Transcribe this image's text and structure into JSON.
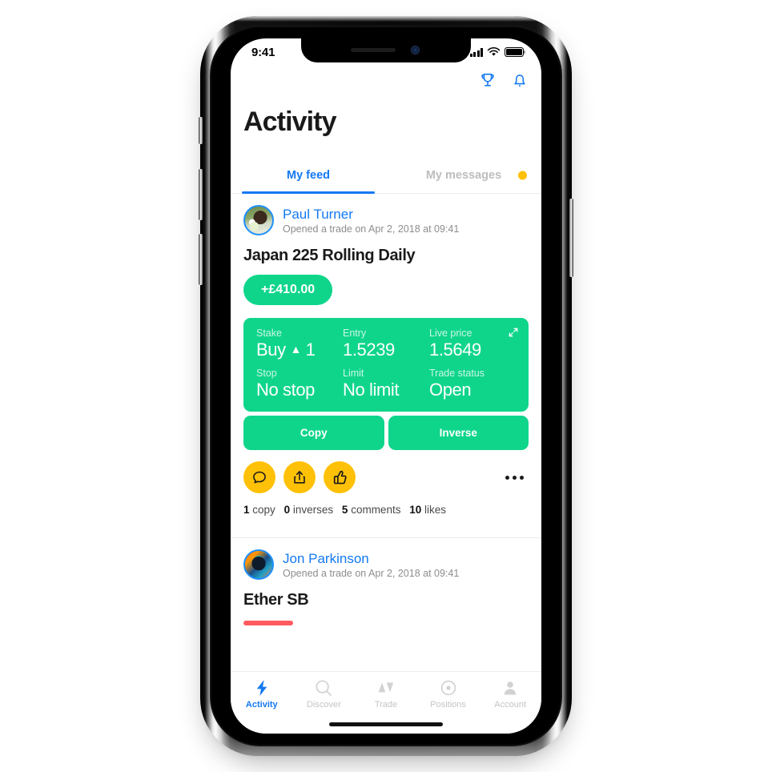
{
  "status_bar": {
    "time": "9:41",
    "signal_icon": "cellular-signal-icon",
    "wifi_icon": "wifi-icon",
    "battery_icon": "battery-full-icon"
  },
  "header": {
    "title": "Activity",
    "icons": [
      {
        "name": "trophy-icon",
        "label": "Leaderboard"
      },
      {
        "name": "bell-icon",
        "label": "Notifications"
      }
    ],
    "accent_color": "#1479f2"
  },
  "tabs": [
    {
      "label": "My feed",
      "active": true
    },
    {
      "label": "My messages",
      "active": false,
      "badge_color": "#ffc107"
    }
  ],
  "feed": {
    "posts": [
      {
        "author": "Paul Turner",
        "subtitle": "Opened a trade on Apr 2, 2018 at 09:41",
        "market": "Japan 225 Rolling Daily",
        "pnl": "+£410.00",
        "pnl_color": "#0fd58b",
        "trade": {
          "stake_label": "Stake",
          "stake_value": "Buy",
          "stake_direction": "▲",
          "stake_size": "1",
          "entry_label": "Entry",
          "entry_value": "1.5239",
          "live_label": "Live price",
          "live_value": "1.5649",
          "stop_label": "Stop",
          "stop_value": "No stop",
          "limit_label": "Limit",
          "limit_value": "No limit",
          "status_label": "Trade status",
          "status_value": "Open",
          "expand_icon": "expand-icon"
        },
        "actions": [
          {
            "label": "Copy"
          },
          {
            "label": "Inverse"
          }
        ],
        "social_buttons": [
          {
            "name": "comment-icon"
          },
          {
            "name": "share-icon"
          },
          {
            "name": "like-icon"
          }
        ],
        "more_icon": "more-options-icon",
        "stats": [
          {
            "count": "1",
            "label": "copy"
          },
          {
            "count": "0",
            "label": "inverses"
          },
          {
            "count": "5",
            "label": "comments"
          },
          {
            "count": "10",
            "label": "likes"
          }
        ]
      },
      {
        "author": "Jon Parkinson",
        "subtitle": "Opened a trade on Apr 2, 2018 at 09:41",
        "market": "Ether SB",
        "pnl_color": "#ff5a5f"
      }
    ]
  },
  "tabbar": [
    {
      "label": "Activity",
      "icon": "lightning-bolt-icon",
      "active": true
    },
    {
      "label": "Discover",
      "icon": "search-icon",
      "active": false
    },
    {
      "label": "Trade",
      "icon": "trade-arrows-icon",
      "active": false
    },
    {
      "label": "Positions",
      "icon": "target-dot-icon",
      "active": false
    },
    {
      "label": "Account",
      "icon": "person-icon",
      "active": false
    }
  ]
}
